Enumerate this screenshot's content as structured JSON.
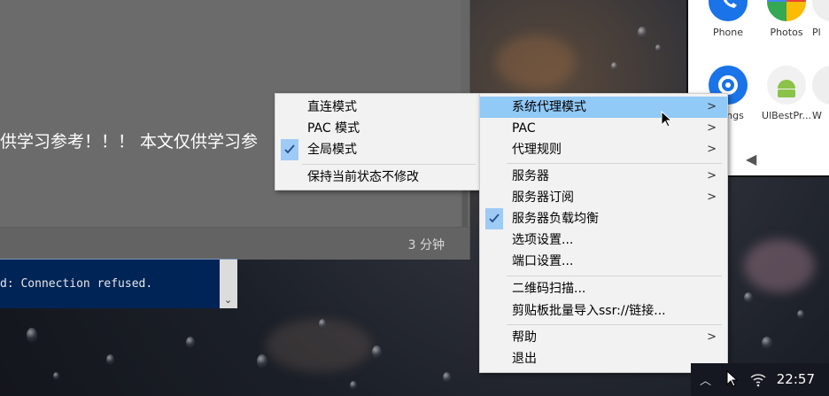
{
  "background_window": {
    "article_text": "供学习参考！！！ 本文仅供学习参",
    "read_time": "3 分钟"
  },
  "console": {
    "line": "d: Connection refused.",
    "scroll_icon": "chevron-down-icon"
  },
  "android": {
    "apps": [
      {
        "label": "Phone",
        "icon": "phone-icon"
      },
      {
        "label": "Photos",
        "icon": "photos-icon"
      },
      {
        "label": "Pl",
        "icon": "play-icon"
      },
      {
        "label": "ngs",
        "icon": "settings-gear-icon"
      },
      {
        "label": "UlBestPr...",
        "icon": "android-icon"
      },
      {
        "label": "W",
        "icon": "app-icon"
      }
    ],
    "back_glyph": "◀"
  },
  "main_menu": {
    "items": [
      {
        "label": "系统代理模式",
        "has_submenu": true,
        "highlighted": true,
        "checked": false
      },
      {
        "label": "PAC",
        "has_submenu": true,
        "checked": false
      },
      {
        "label": "代理规则",
        "has_submenu": true,
        "checked": false
      },
      {
        "label": "服务器",
        "has_submenu": true,
        "checked": false
      },
      {
        "label": "服务器订阅",
        "has_submenu": true,
        "checked": false
      },
      {
        "label": "服务器负载均衡",
        "has_submenu": false,
        "checked": true
      },
      {
        "label": "选项设置...",
        "has_submenu": false,
        "checked": false
      },
      {
        "label": "端口设置...",
        "has_submenu": false,
        "checked": false
      },
      {
        "label": "二维码扫描...",
        "has_submenu": false,
        "checked": false
      },
      {
        "label": "剪贴板批量导入ssr://链接...",
        "has_submenu": false,
        "checked": false
      },
      {
        "label": "帮助",
        "has_submenu": true,
        "checked": false
      },
      {
        "label": "退出",
        "has_submenu": false,
        "checked": false
      }
    ],
    "arrow_glyph": ">"
  },
  "sub_menu": {
    "items": [
      {
        "label": "直连模式",
        "checked": false
      },
      {
        "label": "PAC 模式",
        "checked": false
      },
      {
        "label": "全局模式",
        "checked": true
      },
      {
        "label": "保持当前状态不修改",
        "checked": false
      }
    ]
  },
  "tray": {
    "time": "22:57",
    "up_glyph": "︿"
  },
  "colors": {
    "menu_bg": "#f2f2f2",
    "highlight": "#91c9f7",
    "check_bg": "#9ecbf6",
    "console_bg": "#012456"
  }
}
